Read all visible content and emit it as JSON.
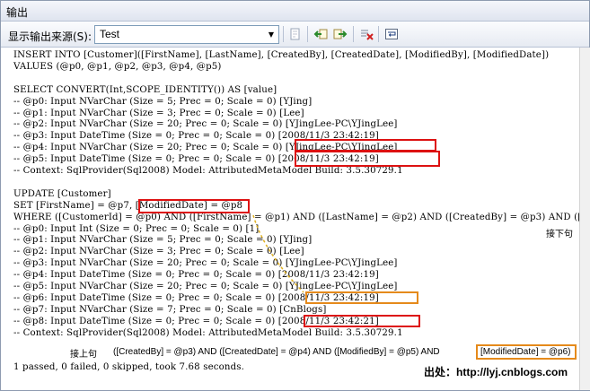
{
  "window": {
    "title": "输出"
  },
  "toolbar": {
    "source_label": "显示输出来源(S):",
    "source_value": "Test",
    "icons": [
      "find-message-icon",
      "previous-message-icon",
      "next-message-icon",
      "clear-all-icon",
      "word-wrap-icon"
    ]
  },
  "output": {
    "lines": [
      "INSERT INTO [Customer]([FirstName], [LastName], [CreatedBy], [CreatedDate], [ModifiedBy], [ModifiedDate])",
      "VALUES (@p0, @p1, @p2, @p3, @p4, @p5)",
      "",
      "SELECT CONVERT(Int,SCOPE_IDENTITY()) AS [value]",
      "-- @p0: Input NVarChar (Size = 5; Prec = 0; Scale = 0) [YJing]",
      "-- @p1: Input NVarChar (Size = 3; Prec = 0; Scale = 0) [Lee]",
      "-- @p2: Input NVarChar (Size = 20; Prec = 0; Scale = 0) [YJingLee-PC\\YJingLee]",
      "-- @p3: Input DateTime (Size = 0; Prec = 0; Scale = 0) [2008/11/3 23:42:19]",
      "-- @p4: Input NVarChar (Size = 20; Prec = 0; Scale = 0) [YJingLee-PC\\YJingLee]",
      "-- @p5: Input DateTime (Size = 0; Prec = 0; Scale = 0) [2008/11/3 23:42:19]",
      "-- Context: SqlProvider(Sql2008) Model: AttributedMetaModel Build: 3.5.30729.1",
      "",
      "UPDATE [Customer]",
      "SET [FirstName] = @p7, [ModifiedDate] = @p8",
      "WHERE ([CustomerId] = @p0) AND ([FirstName] = @p1) AND ([LastName] = @p2) AND ([CreatedBy] = @p3) AND ([Cr",
      "-- @p0: Input Int (Size = 0; Prec = 0; Scale = 0) [1]",
      "-- @p1: Input NVarChar (Size = 5; Prec = 0; Scale = 0) [YJing]",
      "-- @p2: Input NVarChar (Size = 3; Prec = 0; Scale = 0) [Lee]",
      "-- @p3: Input NVarChar (Size = 20; Prec = 0; Scale = 0) [YJingLee-PC\\YJingLee]",
      "-- @p4: Input DateTime (Size = 0; Prec = 0; Scale = 0) [2008/11/3 23:42:19]",
      "-- @p5: Input NVarChar (Size = 20; Prec = 0; Scale = 0) [YJingLee-PC\\YJingLee]",
      "-- @p6: Input DateTime (Size = 0; Prec = 0; Scale = 0) [2008/11/3 23:42:19]",
      "-- @p7: Input NVarChar (Size = 7; Prec = 0; Scale = 0) [CnBlogs]",
      "-- @p8: Input DateTime (Size = 0; Prec = 0; Scale = 0) [2008/11/3 23:42:21]",
      "-- Context: SqlProvider(Sql2008) Model: AttributedMetaModel Build: 3.5.30729.1",
      "",
      "",
      "1 passed, 0 failed, 0 skipped, took 7.68 seconds."
    ]
  },
  "annotations": {
    "next_line_label": "接下句",
    "continuation_label": "接上句",
    "continuation_text": "([CreatedBy] = @p3) AND ([CreatedDate] = @p4) AND ([ModifiedBy] = @p5) AND ",
    "continuation_highlight": "[ModifiedDate] = @p6)",
    "source_credit": "出处：http://lyj.cnblogs.com"
  },
  "colors": {
    "highlight_red": "#dd1111",
    "highlight_orange": "#e58a1b"
  }
}
